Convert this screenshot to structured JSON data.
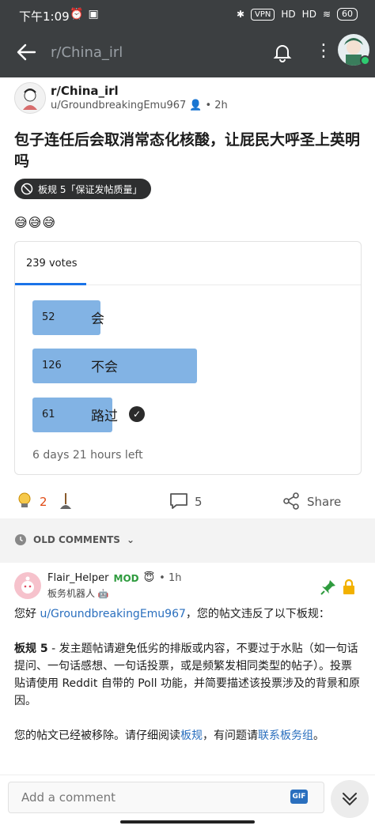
{
  "status": {
    "time": "下午1:09",
    "vpn": "VPN",
    "net1": "HD",
    "net2": "HD",
    "battery": "60"
  },
  "appbar": {
    "title": "r/China_irl"
  },
  "post": {
    "subreddit": "r/China_irl",
    "author": "u/GroundbreakingEmu967",
    "age": "• 2h",
    "title": "包子连任后会取消常态化核酸，让屁民大呼圣上英明吗",
    "flair": "板规 5「保证发帖质量」",
    "emojis": "😅😅😅"
  },
  "poll": {
    "total": "239 votes",
    "options": [
      {
        "count": "52",
        "label": "会",
        "fraction": 0.2176
      },
      {
        "count": "126",
        "label": "不会",
        "fraction": 0.5272
      },
      {
        "count": "61",
        "label": "路过",
        "fraction": 0.2552,
        "selected": true
      }
    ],
    "time_left": "6 days 21 hours left"
  },
  "actions": {
    "score": "2",
    "comments": "5",
    "share": "Share"
  },
  "sort": {
    "label": "OLD COMMENTS"
  },
  "comment": {
    "author": "Flair_Helper",
    "mod": "MOD",
    "age": "• 1h",
    "flair": "板务机器人",
    "greeting_pre": "您好 ",
    "greeting_link": "u/GroundbreakingEmu967",
    "greeting_post": "，您的帖文违反了以下板规：",
    "rule_bold": "板规 5",
    "rule_text": " - 发主题帖请避免低劣的排版或内容，不要过于水贴（如一句话提问、一句话感想、一句话投票，或是频繁发相同类型的帖子）。投票贴请使用 Reddit 自带的 Poll 功能，并简要描述该投票涉及的背景和原因。",
    "removed_pre": "您的帖文已经被移除。请仔细阅读",
    "removed_link1": "板规",
    "removed_mid": "，有问题请",
    "removed_link2": "联系板务组",
    "removed_post": "。"
  },
  "bottom": {
    "placeholder": "Add a comment",
    "gif": "GIF"
  },
  "colors": {
    "bar": "#82b3e4",
    "link": "#2a6fbe",
    "mod": "#2e9b3e",
    "header": "#3c3f41"
  }
}
